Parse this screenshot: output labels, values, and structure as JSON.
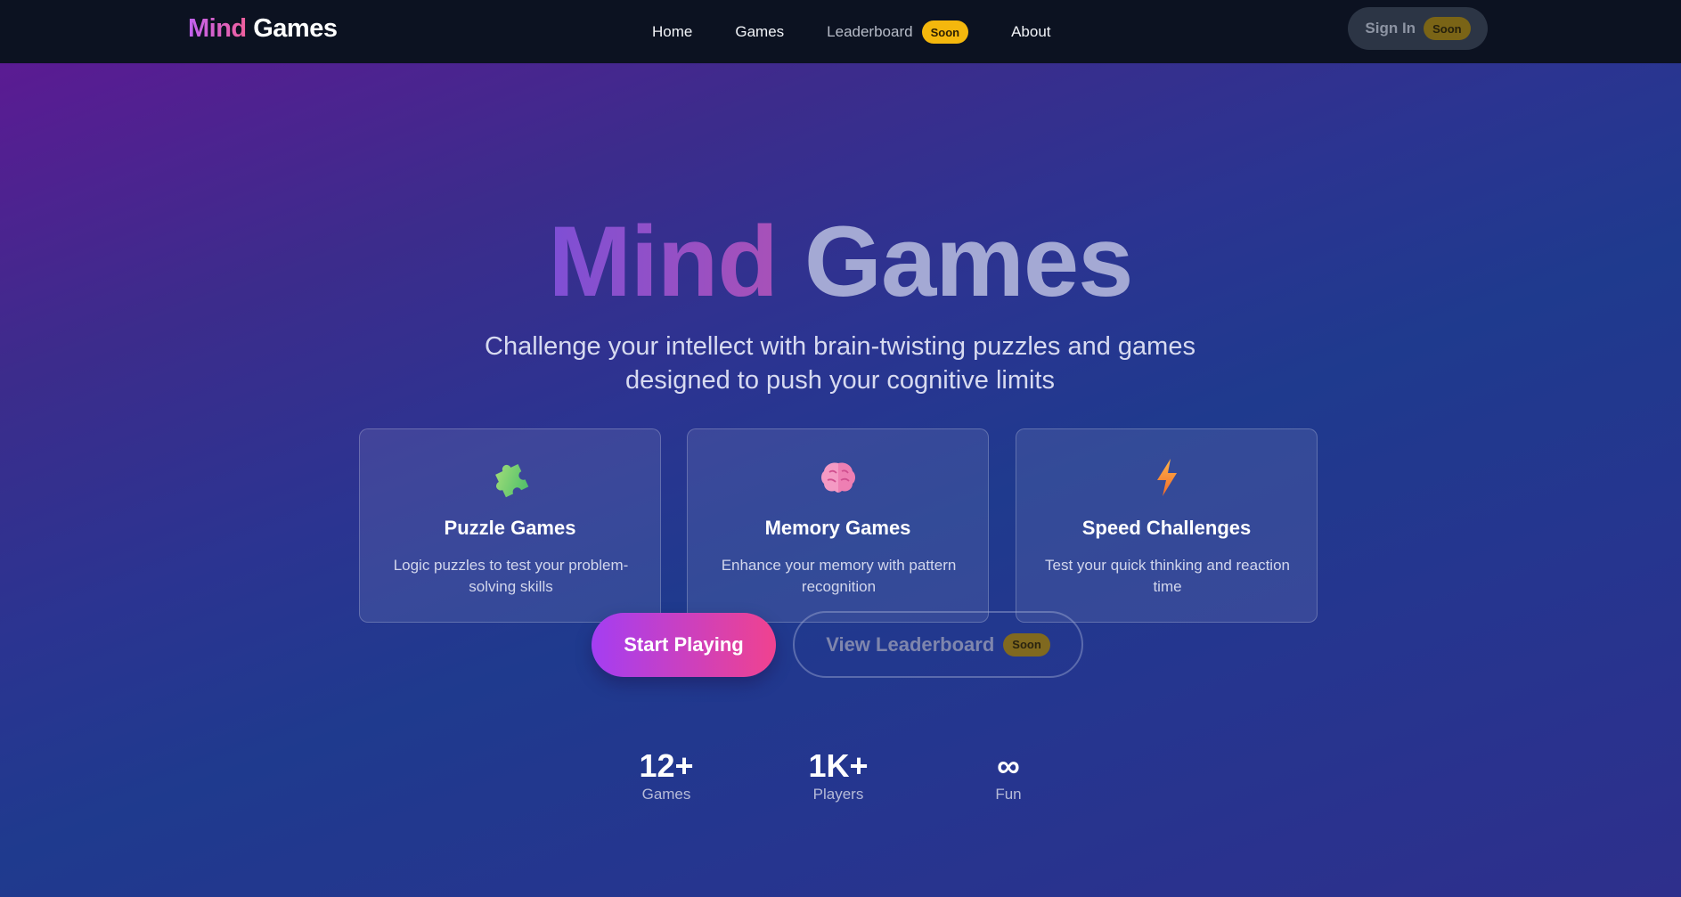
{
  "nav": {
    "logo_part1": "Mind",
    "logo_part2": "Games",
    "links": [
      "Home",
      "Games",
      "Leaderboard",
      "About"
    ],
    "leaderboard_badge": "Soon",
    "signin_label": "Sign In",
    "signin_badge": "Soon"
  },
  "hero": {
    "title_part1": "Mind",
    "title_part2": "Games",
    "subtitle_line1": "Challenge your intellect with brain-twisting puzzles and games",
    "subtitle_line2": "designed to push your cognitive limits"
  },
  "cards": [
    {
      "icon": "puzzle-piece-icon",
      "title": "Puzzle Games",
      "desc": "Logic puzzles to test your problem-solving skills"
    },
    {
      "icon": "brain-icon",
      "title": "Memory Games",
      "desc": "Enhance your memory with pattern recognition"
    },
    {
      "icon": "lightning-icon",
      "title": "Speed Challenges",
      "desc": "Test your quick thinking and reaction time"
    }
  ],
  "buttons": {
    "start": "Start Playing",
    "leaderboard": "View Leaderboard",
    "leaderboard_badge": "Soon"
  },
  "stats": [
    {
      "value": "12+",
      "label": "Games"
    },
    {
      "value": "1K+",
      "label": "Players"
    },
    {
      "value": "∞",
      "label": "Fun"
    }
  ],
  "colors": {
    "nav_bg": "#0c1221",
    "badge": "#f4b70d",
    "accent_start": "#a43ef2",
    "accent_end": "#f0428f"
  }
}
